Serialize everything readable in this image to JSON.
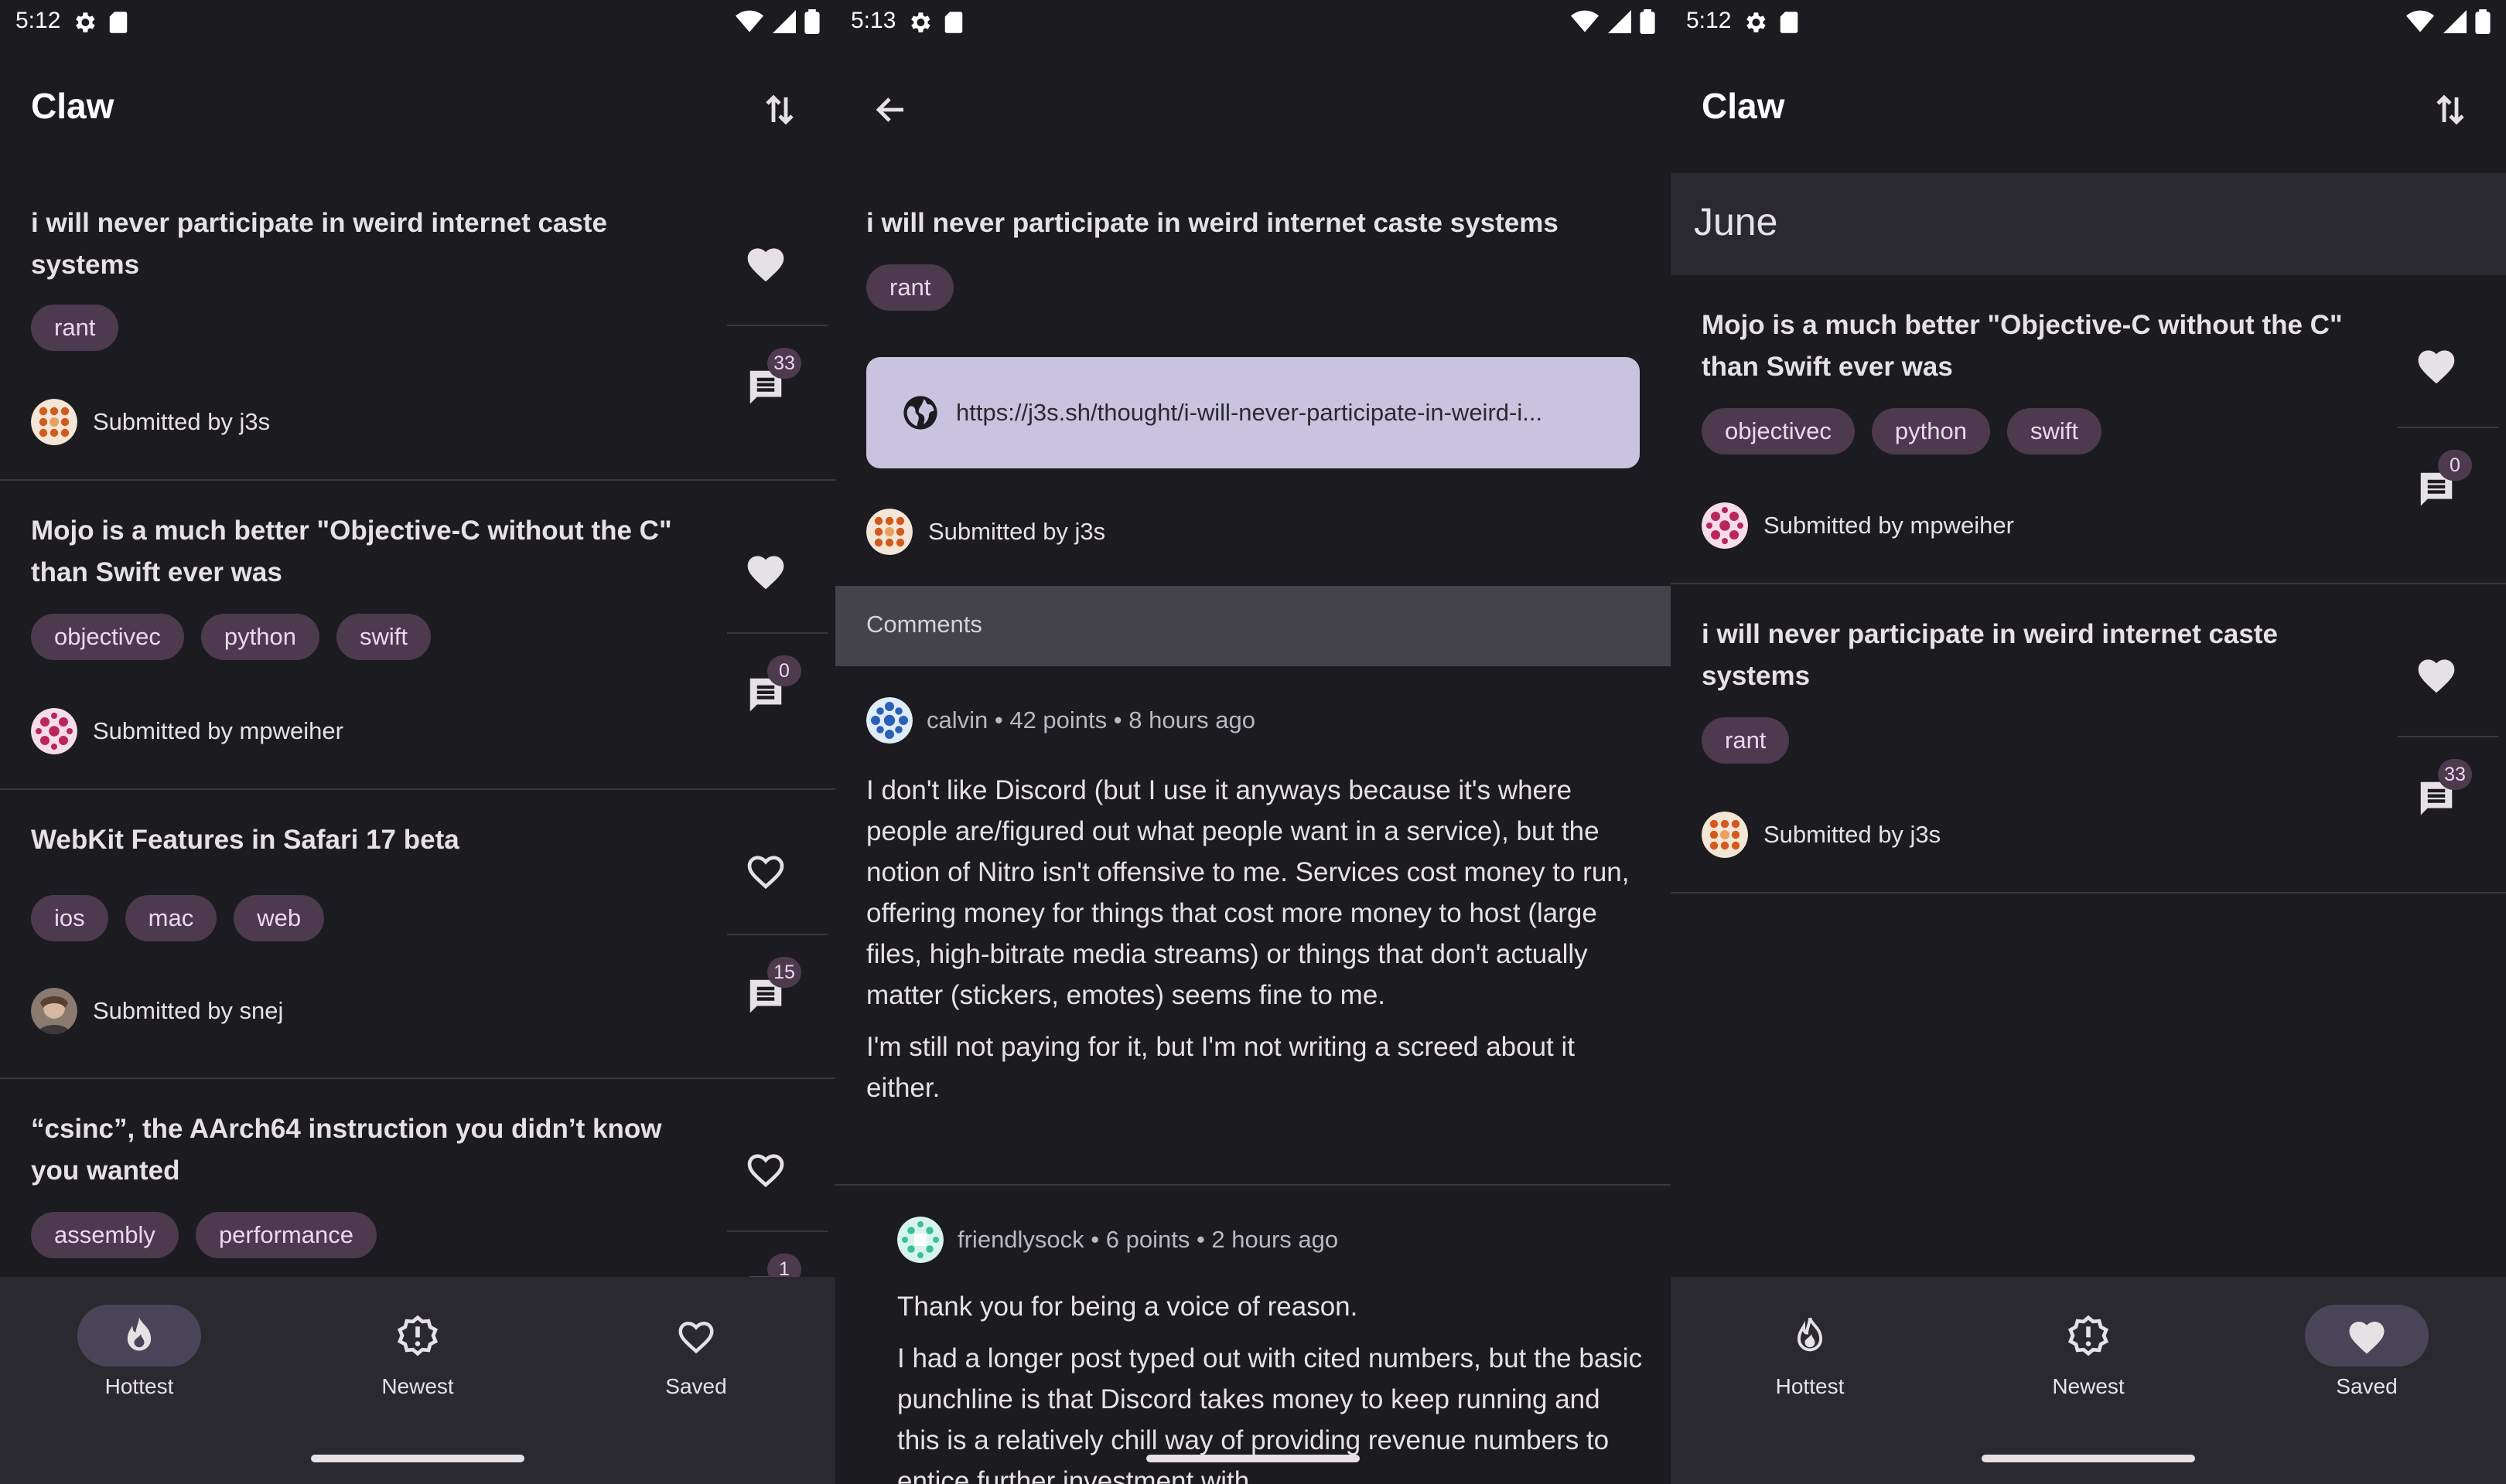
{
  "screens": {
    "hottest": {
      "status_time": "5:12",
      "app_title": "Claw",
      "stories": [
        {
          "title": "i will never participate in weird internet caste systems",
          "tags": [
            "rant"
          ],
          "submitter": "Submitted by j3s",
          "comments": "33",
          "favorited": true
        },
        {
          "title": "Mojo is a much better \"Objective-C without the C\" than Swift ever was",
          "tags": [
            "objectivec",
            "python",
            "swift"
          ],
          "submitter": "Submitted by mpweiher",
          "comments": "0",
          "favorited": true
        },
        {
          "title": "WebKit Features in Safari 17 beta",
          "tags": [
            "ios",
            "mac",
            "web"
          ],
          "submitter": "Submitted by snej",
          "comments": "15",
          "favorited": false
        },
        {
          "title": "“csinc”, the AArch64 instruction you didn’t know you wanted",
          "tags": [
            "assembly",
            "performance"
          ],
          "submitter": "",
          "comments": "1",
          "favorited": false
        }
      ]
    },
    "detail": {
      "status_time": "5:13",
      "title": "i will never participate in weird internet caste systems",
      "tags": [
        "rant"
      ],
      "link": "https://j3s.sh/thought/i-will-never-participate-in-weird-i...",
      "submitter": "Submitted by j3s",
      "comments_header": "Comments",
      "comments": [
        {
          "meta": "calvin • 42 points • 8 hours ago",
          "paragraphs": [
            "I don't like Discord (but I use it anyways because it's where people are/figured out what people want in a service), but the notion of Nitro isn't offensive to me. Services cost money to run, offering money for things that cost more money to host (large files, high-bitrate media streams) or things that don't actually matter (stickers, emotes) seems fine to me.",
            "I'm still not paying for it, but I'm not writing a screed about it either."
          ]
        },
        {
          "meta": "friendlysock • 6 points • 2 hours ago",
          "paragraphs": [
            "Thank you for being a voice of reason.",
            "I had a longer post typed out with cited numbers, but the basic punchline is that Discord takes money to keep running and this is a relatively chill way of providing revenue numbers to entice further investment with."
          ]
        }
      ]
    },
    "saved": {
      "status_time": "5:12",
      "app_title": "Claw",
      "month": "June",
      "stories": [
        {
          "title": "Mojo is a much better \"Objective-C without the C\" than Swift ever was",
          "tags": [
            "objectivec",
            "python",
            "swift"
          ],
          "submitter": "Submitted by mpweiher",
          "comments": "0",
          "favorited": true
        },
        {
          "title": "i will never participate in weird internet caste systems",
          "tags": [
            "rant"
          ],
          "submitter": "Submitted by j3s",
          "comments": "33",
          "favorited": true
        }
      ]
    }
  },
  "nav": {
    "hottest": "Hottest",
    "newest": "Newest",
    "saved": "Saved"
  },
  "colors": {
    "background": "#1c1b1f",
    "tag": "#4d3a4f",
    "nav_active": "#4a4458",
    "link_card": "#c9c3df"
  },
  "icons": [
    "gear-icon",
    "sd-card-icon",
    "wifi-icon",
    "signal-icon",
    "battery-icon",
    "sort-icon",
    "back-arrow-icon",
    "heart-icon",
    "heart-outline-icon",
    "comment-icon",
    "globe-icon",
    "flame-icon",
    "alert-icon"
  ]
}
